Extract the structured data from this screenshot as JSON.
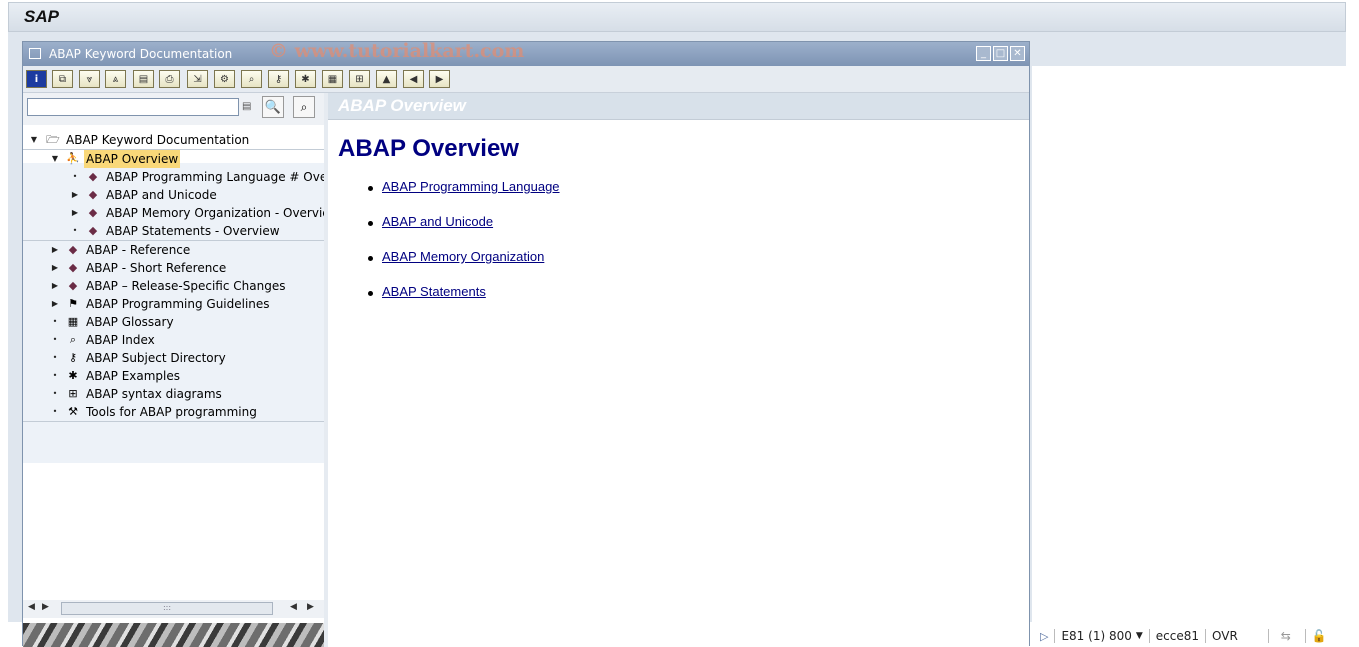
{
  "app": {
    "logo": "SAP"
  },
  "window": {
    "title": "ABAP Keyword Documentation",
    "watermark": "© www.tutorialkart.com"
  },
  "search": {
    "value": "",
    "placeholder": ""
  },
  "tree": {
    "root": "ABAP Keyword Documentation",
    "overview": "ABAP Overview",
    "overview_children": [
      "ABAP Programming Language # Overview",
      "ABAP and Unicode",
      "ABAP Memory Organization - Overview",
      "ABAP Statements - Overview"
    ],
    "items": [
      "ABAP - Reference",
      "ABAP - Short Reference",
      "ABAP – Release-Specific Changes",
      "ABAP Programming Guidelines",
      "ABAP Glossary",
      "ABAP Index",
      "ABAP Subject Directory",
      "ABAP Examples",
      "ABAP syntax diagrams",
      "Tools for ABAP programming"
    ]
  },
  "content": {
    "header": "ABAP Overview",
    "title": "ABAP Overview",
    "links": [
      "ABAP Programming Language",
      "ABAP and Unicode",
      "ABAP Memory Organization",
      "ABAP Statements"
    ]
  },
  "status": {
    "system": "E81 (1) 800",
    "server": "ecce81",
    "mode": "OVR"
  }
}
